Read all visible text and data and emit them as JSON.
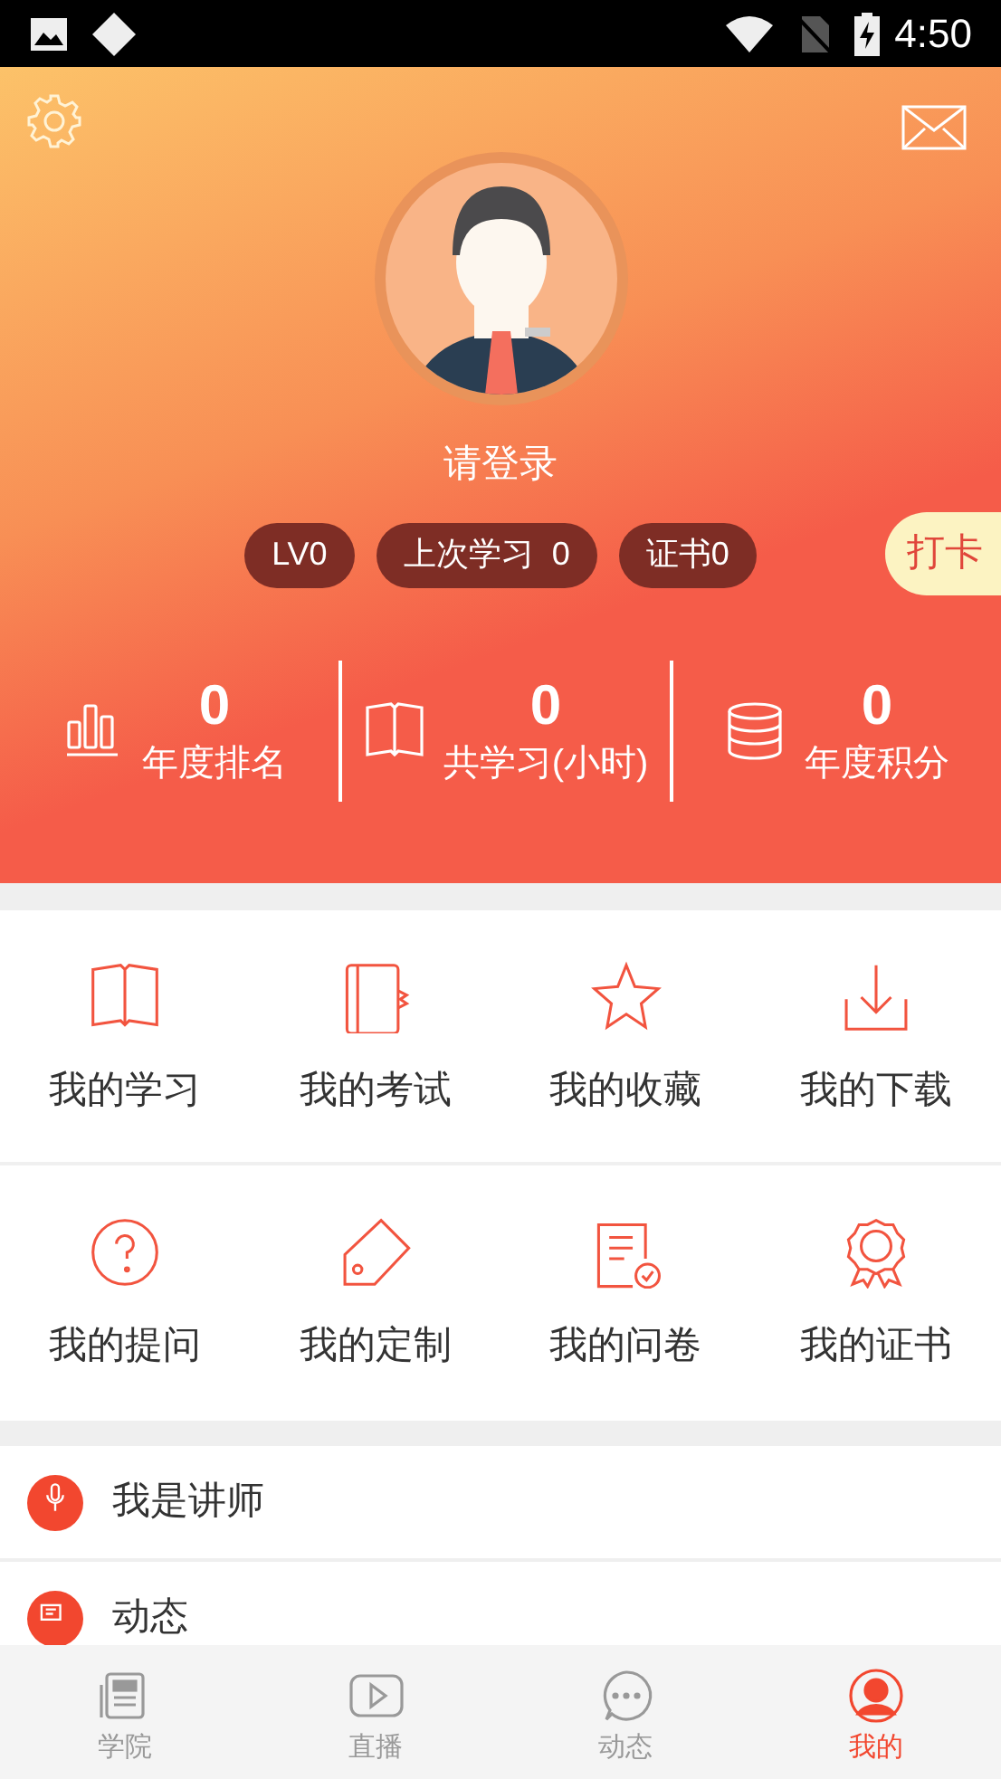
{
  "status_bar": {
    "time": "4:50"
  },
  "profile": {
    "login_prompt": "请登录",
    "badges": [
      "LV0",
      "上次学习  0",
      "证书0"
    ],
    "check_in": "打卡"
  },
  "stats": [
    {
      "value": "0",
      "label": "年度排名"
    },
    {
      "value": "0",
      "label": "共学习(小时)"
    },
    {
      "value": "0",
      "label": "年度积分"
    }
  ],
  "grid": [
    {
      "label": "我的学习"
    },
    {
      "label": "我的考试"
    },
    {
      "label": "我的收藏"
    },
    {
      "label": "我的下载"
    },
    {
      "label": "我的提问"
    },
    {
      "label": "我的定制"
    },
    {
      "label": "我的问卷"
    },
    {
      "label": "我的证书"
    }
  ],
  "list": [
    {
      "label": "我是讲师"
    },
    {
      "label": "动态"
    }
  ],
  "tabs": [
    {
      "label": "学院",
      "selected": false
    },
    {
      "label": "直播",
      "selected": false
    },
    {
      "label": "动态",
      "selected": false
    },
    {
      "label": "我的",
      "selected": true
    }
  ]
}
